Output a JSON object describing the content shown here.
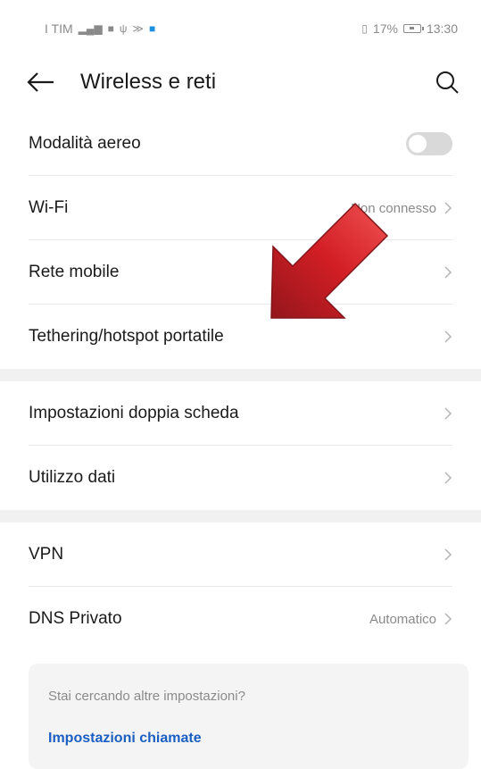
{
  "statusbar": {
    "carrier": "I TIM",
    "battery_text": "17%",
    "time": "13:30"
  },
  "appbar": {
    "title": "Wireless e reti"
  },
  "icons": {
    "back": "arrow-left-icon",
    "search": "search-icon",
    "chevron": "chevron-right-icon"
  },
  "rows": [
    {
      "label": "Modalità aereo",
      "toggle": "off"
    },
    {
      "label": "Wi-Fi",
      "value": "Non connesso"
    },
    {
      "label": "Rete mobile"
    },
    {
      "label": "Tethering/hotspot portatile"
    },
    {
      "label": "Impostazioni doppia scheda"
    },
    {
      "label": "Utilizzo dati"
    },
    {
      "label": "VPN"
    },
    {
      "label": "DNS Privato",
      "value": "Automatico"
    }
  ],
  "card": {
    "question": "Stai cercando altre impostazioni?",
    "link": "Impostazioni chiamate"
  },
  "colors": {
    "link": "#1b5fc2",
    "arrow": "#d0121a"
  }
}
